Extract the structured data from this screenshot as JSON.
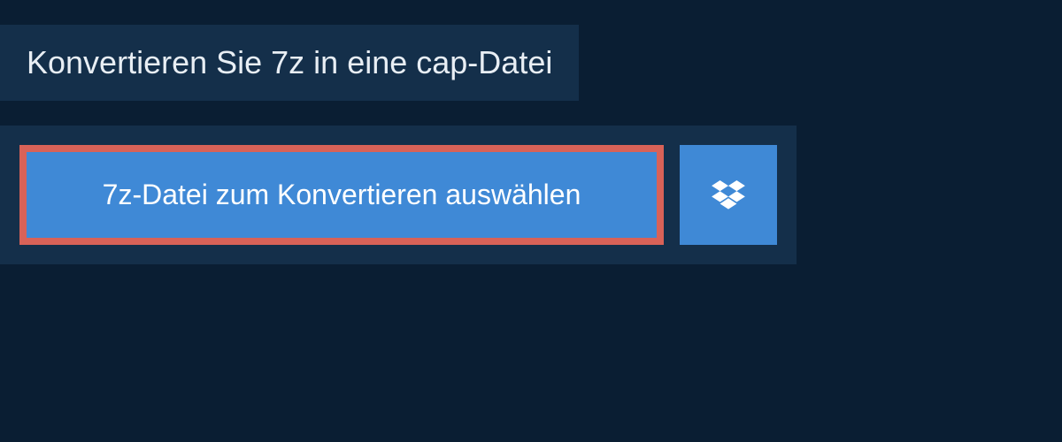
{
  "header": {
    "title": "Konvertieren Sie 7z in eine cap-Datei"
  },
  "upload": {
    "selectFileLabel": "7z-Datei zum Konvertieren auswählen"
  },
  "colors": {
    "background": "#0a1e33",
    "panel": "#142f4a",
    "buttonPrimary": "#3f89d6",
    "highlightBorder": "#d86258",
    "text": "#ffffff"
  }
}
